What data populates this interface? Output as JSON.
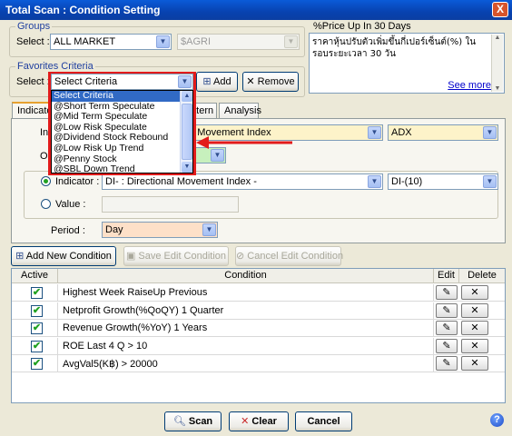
{
  "window": {
    "title": "Total Scan : Condition Setting",
    "close_glyph": "X"
  },
  "groups": {
    "label": "Groups",
    "select_label": "Select :",
    "market_value": "ALL MARKET",
    "sub_value": "$AGRI"
  },
  "favorites": {
    "label": "Favorites Criteria",
    "select_label": "Select :",
    "value": "Select Criteria",
    "add_label": "Add",
    "remove_label": "Remove",
    "options": [
      "Select Criteria",
      "@Short Term Speculate",
      "@Mid Term Speculate",
      "@Low Risk Speculate",
      "@Dividend Stock Rebound",
      "@Low Risk Up Trend",
      "@Penny Stock",
      "@SBL Down Trend"
    ]
  },
  "description": {
    "title": "%Price Up In 30 Days",
    "text": "ราคาหุ้นปรับตัวเพิ่มขึ้นกี่เปอร์เซ็นต์(%) ในรอบระยะเวลา 30 วัน",
    "see_more": "See more"
  },
  "tabs": {
    "indicator": "Indicato",
    "pattern": "attern",
    "analysis": "Analysis"
  },
  "indicator_section": {
    "row1_prefix": "In",
    "row1_value": "on Movement Index",
    "row1_param": "ADX",
    "row2_prefix": "O",
    "indicator_label": "Indicator :",
    "indicator_value": "DI- : Directional Movement Index -",
    "indicator_param": "DI-(10)",
    "value_label": "Value :",
    "period_label": "Period :",
    "period_value": "Day"
  },
  "actions": {
    "add_new": "Add New Condition",
    "save_edit": "Save Edit Condition",
    "cancel_edit": "Cancel Edit Condition"
  },
  "table": {
    "headers": {
      "active": "Active",
      "condition": "Condition",
      "edit": "Edit",
      "delete": "Delete"
    },
    "rows": [
      {
        "active": true,
        "condition": "Highest Week RaiseUp Previous"
      },
      {
        "active": true,
        "condition": "Netprofit Growth(%QoQY) 1 Quarter"
      },
      {
        "active": true,
        "condition": "Revenue Growth(%YoY) 1 Years"
      },
      {
        "active": true,
        "condition": "ROE Last 4 Q > 10"
      },
      {
        "active": true,
        "condition": "AvgVal5(K฿) > 20000"
      }
    ]
  },
  "footer": {
    "scan": "Scan",
    "clear": "Clear",
    "cancel": "Cancel",
    "help": "?"
  }
}
